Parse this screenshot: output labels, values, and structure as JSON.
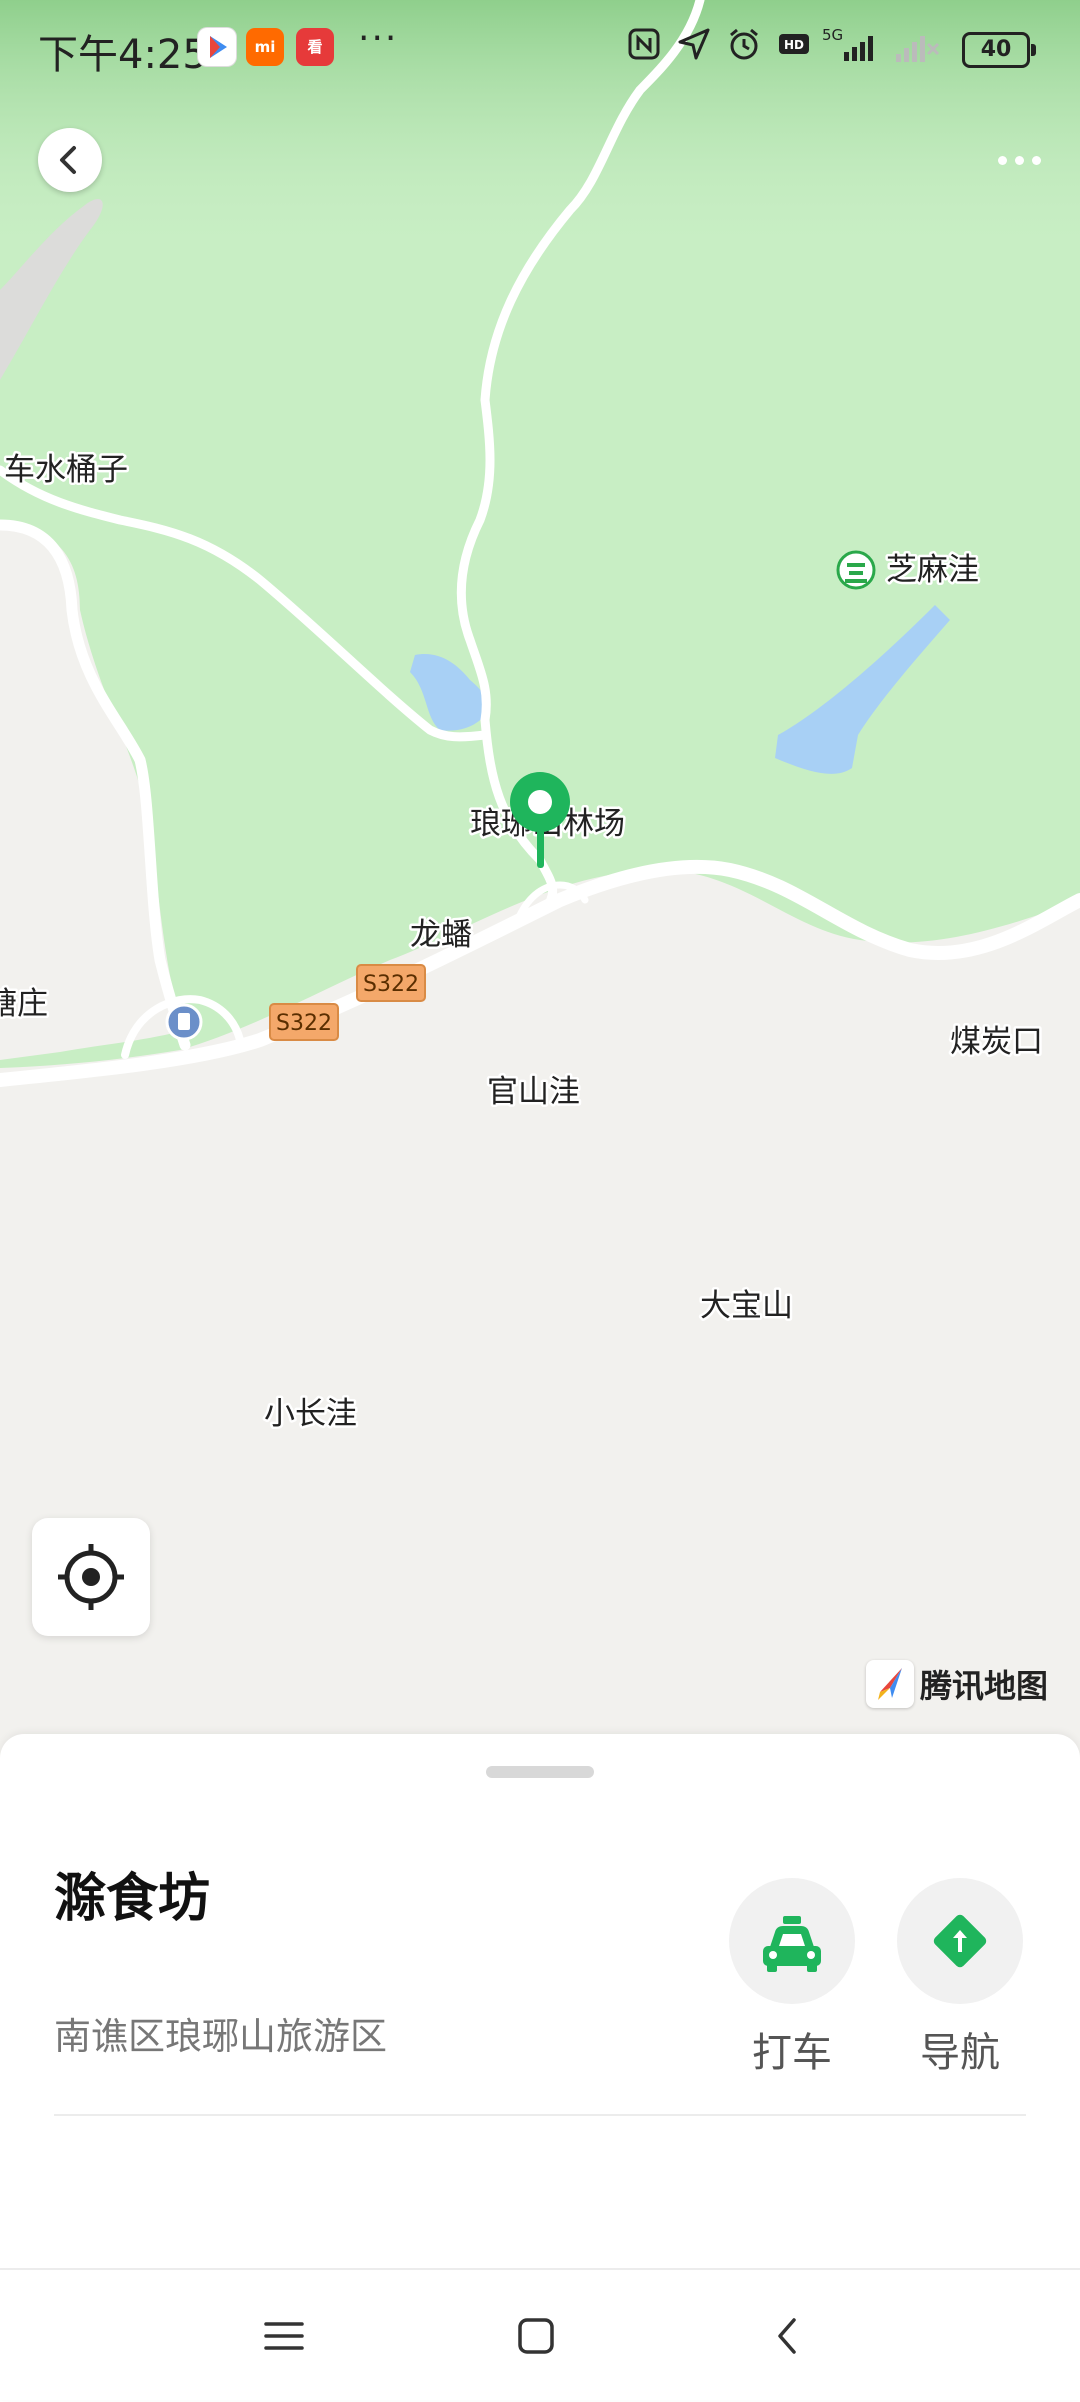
{
  "status_bar": {
    "time": "下午4:25",
    "more": "···",
    "app_icons": [
      "play-store-icon",
      "mi-store-icon",
      "news-app-icon"
    ],
    "indicators": [
      "nfc-icon",
      "location-icon",
      "alarm-icon",
      "hd-icon"
    ],
    "network": "5G",
    "battery": "40"
  },
  "map": {
    "labels": {
      "chesuitongzi": "车水桶子",
      "zhimawa": "芝麻洼",
      "forest_farm": "琅琊山林场",
      "longfan": "龙蟠",
      "tangzhuang": "塘庄",
      "meitankou": "煤炭口",
      "guanshanwa": "官山洼",
      "dabaoshan": "大宝山",
      "xiaochangwa": "小长洼",
      "road_1": "S322",
      "road_2": "S322"
    },
    "attribution": "腾讯地图",
    "colors": {
      "green_area": "#c8eec4",
      "land": "#f2f1ee",
      "water": "#a8d0f5",
      "road": "#ffffff",
      "pin": "#1fb55c",
      "road_badge": "#f4a86a"
    }
  },
  "place": {
    "name": "滁食坊",
    "address": "南谯区琅琊山旅游区"
  },
  "actions": {
    "taxi_label": "打车",
    "navigate_label": "导航"
  }
}
